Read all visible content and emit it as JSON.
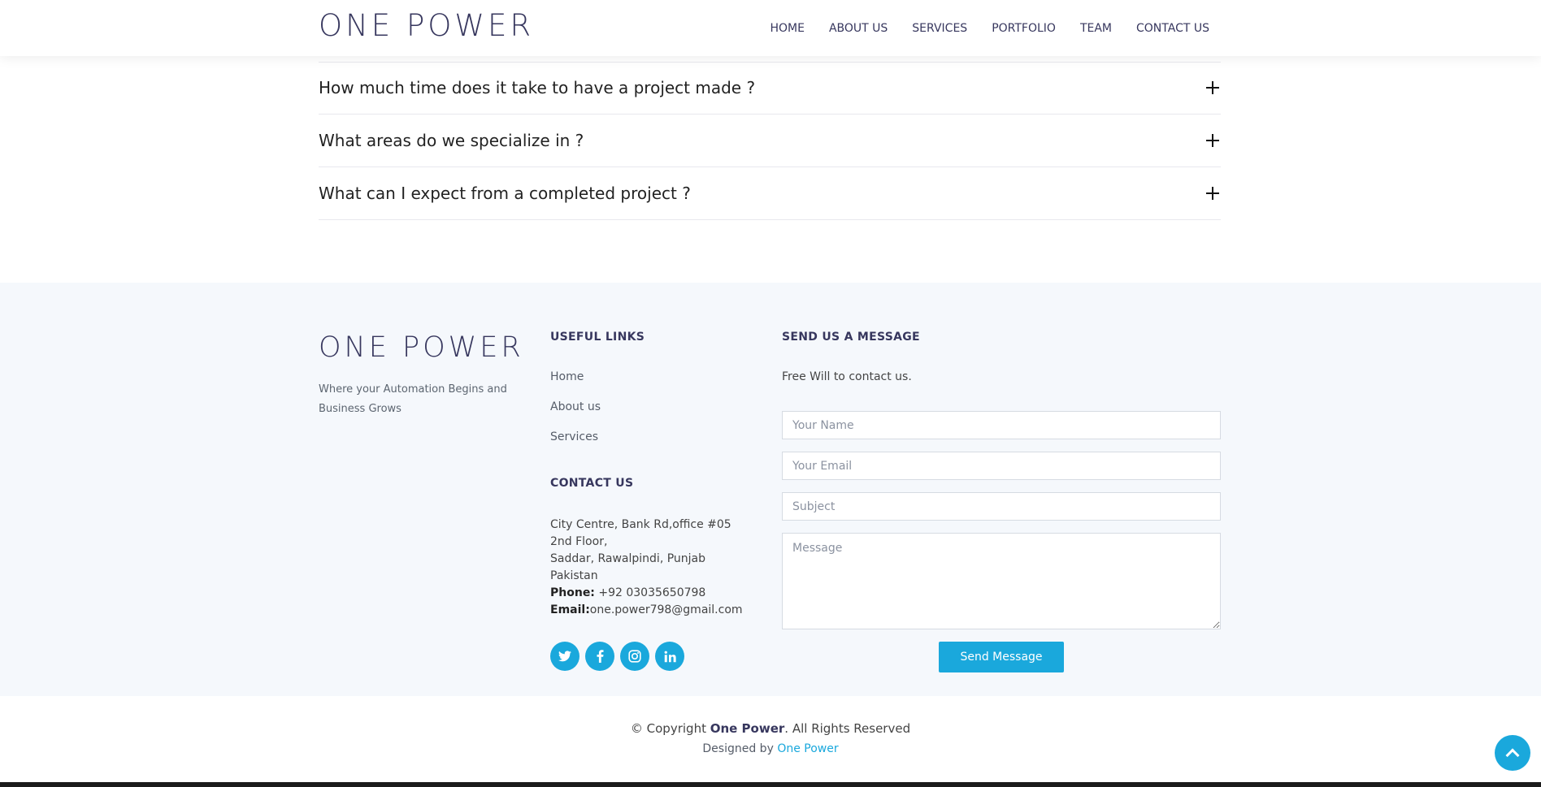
{
  "header": {
    "logo": "ONE POWER",
    "nav": [
      "HOME",
      "ABOUT US",
      "SERVICES",
      "PORTFOLIO",
      "TEAM",
      "CONTACT US"
    ]
  },
  "faq": [
    "How much time does it take to have a project made ?",
    "What areas do we specialize in ?",
    "What can I expect from a completed project ?"
  ],
  "footer": {
    "logo": "ONE POWER",
    "tagline": "Where your Automation Begins and Business Grows",
    "useful_links": {
      "heading": "USEFUL LINKS",
      "items": [
        "Home",
        "About us",
        "Services"
      ]
    },
    "contact": {
      "heading": "CONTACT US",
      "address_line1": "City Centre, Bank Rd,office #05 2nd Floor,",
      "address_line2": "Saddar, Rawalpindi, Punjab",
      "country": "Pakistan",
      "phone_label": "Phone:",
      "phone": "+92 03035650798",
      "email_label": "Email:",
      "email": "one.power798@gmail.com"
    },
    "socials": [
      "twitter-icon",
      "facebook-icon",
      "instagram-icon",
      "linkedin-icon"
    ],
    "message": {
      "heading": "SEND US A MESSAGE",
      "subtitle": "Free Will to contact us.",
      "name_placeholder": "Your Name",
      "email_placeholder": "Your Email",
      "subject_placeholder": "Subject",
      "message_placeholder": "Message",
      "button": "Send Message"
    },
    "copyright": {
      "prefix": "© Copyright",
      "brand": "One Power",
      "suffix": ". All Rights Reserved"
    },
    "credits": {
      "prefix": "Designed by",
      "link": "One Power"
    }
  },
  "colors": {
    "accent": "#1aa8dc",
    "brand": "#37375e",
    "footer_bg": "#f5f8fc"
  }
}
